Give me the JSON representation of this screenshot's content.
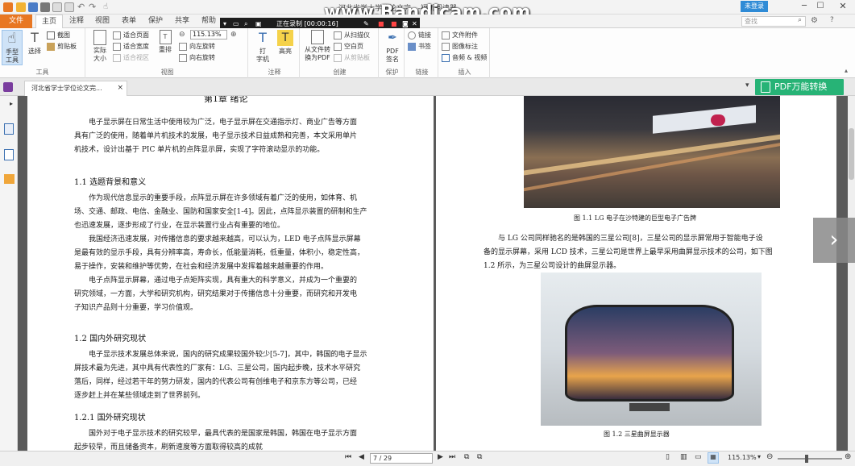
{
  "title_bar": {
    "title": "河北省学士学位论文完...-福昕阅读器",
    "login": "未登录",
    "search_placeholder": "查找"
  },
  "watermark": "www.Bandicam.com",
  "menu_tabs": [
    "文件",
    "主页",
    "注释",
    "视图",
    "表单",
    "保护",
    "共享",
    "帮助"
  ],
  "recorder": {
    "status": "正在录制 [00:00:16]"
  },
  "ribbon": {
    "tools": {
      "hand": "手型\n工具",
      "select": "选择",
      "snapshot": "截图",
      "clipboard": "剪贴板",
      "group": "工具"
    },
    "view": {
      "actual": "实际\n大小",
      "fit_page": "适合页面",
      "fit_width": "适合宽度",
      "fit_visible": "适合视区",
      "reflow": "重排",
      "zoom": "115.13%",
      "rotate_left": "向左旋转",
      "rotate_right": "向右旋转",
      "group": "视图"
    },
    "comment": {
      "typewriter": "打\n字机",
      "highlight": "高亮",
      "group": "注释"
    },
    "create": {
      "from_file": "从文件转\n换为PDF",
      "from_scanner": "从扫描仪",
      "blank": "空白页",
      "from_clipboard": "从剪贴板",
      "group": "创建"
    },
    "protect": {
      "sign": "PDF\n签名",
      "group": "保护"
    },
    "links": {
      "link": "链接",
      "bookmark": "书签",
      "group": "链接"
    },
    "insert": {
      "attachment": "文件附件",
      "image": "图像标注",
      "audio_video": "音频 & 视频",
      "group": "插入"
    }
  },
  "doc_tab": {
    "label": "河北省学士学位论文完..."
  },
  "convert_button": "PDF万能转换",
  "page_left": {
    "chapter": "第1章  绪论",
    "intro": [
      "电子显示屏在日常生活中使用较为广泛，电子显示屏在交通指示灯、商业广告等方面",
      "具有广泛的使用，随着单片机技术的发展，电子显示技术日益成熟和完善，本文采用单片",
      "机技术，设计出基于 PIC 单片机的点阵显示屏，实现了字符滚动显示的功能。"
    ],
    "s11": "1.1   选题背景和意义",
    "s11_p1": [
      "作为现代信息显示的重要手段，点阵显示屏在许多领域有着广泛的使用，如体育、机",
      "场、交通、邮政、电信、金融业、国防和国家安全[1-4]。因此，点阵显示装置的研制和生产",
      "也迅速发展，逐步形成了行业，在显示装置行业占有重要的地位。"
    ],
    "s11_p2": [
      "我国经济迅速发展，对传播信息的要求越来越高，可以认为，LED 电子点阵显示屏幕",
      "是最有效的显示手段，具有分辨率高，寿命长，低能量消耗，低重量，体积小，稳定性高，",
      "易于操作，安装和维护等优势，在社会和经济发展中发挥着越来越重要的作用。"
    ],
    "s11_p3": [
      "电子点阵显示屏幕，通过电子点矩阵实现，具有重大的科学意义，并成为一个重要的",
      "研究领域，一方面，大学和研究机构，研究结果对于传播信息十分重要，而研究和开发电",
      "子知识产品则十分重要，学习价值观。"
    ],
    "s12": "1.2   国内外研究现状",
    "s12_p1": [
      "电子显示技术发展总体来说，国内的研究成果较国外较少[5-7]，其中，韩国的电子显示",
      "屏技术最为先进，其中具有代表性的厂家有：LG、三星公司，国内起步晚，技术水平研究",
      "落后，同样，经过若干年的努力研发，国内的代表公司有创维电子和京东方等公司，已经",
      "逐步赶上并在某些领域走到了世界前列。"
    ],
    "s121": "1.2.1   国外研究现状",
    "s121_p1": [
      "国外对于电子显示技术的研究较早，最具代表的是国家是韩国，韩国在电子显示方面",
      "起步较早，而且储备资本，刷新速度等方面取得较高的成就"
    ]
  },
  "page_right": {
    "fig1": "图 1.1   LG 电子在沙特建的巨型电子广告牌",
    "para": [
      "与 LG 公司同样驰名的是韩国的三星公司[8]，三星公司的显示屏常用于智能电子设",
      "备的显示屏幕，采用 LCD 技术，三星公司是世界上最早采用曲屏显示技术的公司，如下图",
      "1.2 所示，为三星公司设计的曲屏显示器。"
    ],
    "fig2": "图 1.2   三星曲屏显示器"
  },
  "statusbar": {
    "page": "7 / 29",
    "zoom": "115.13%"
  }
}
